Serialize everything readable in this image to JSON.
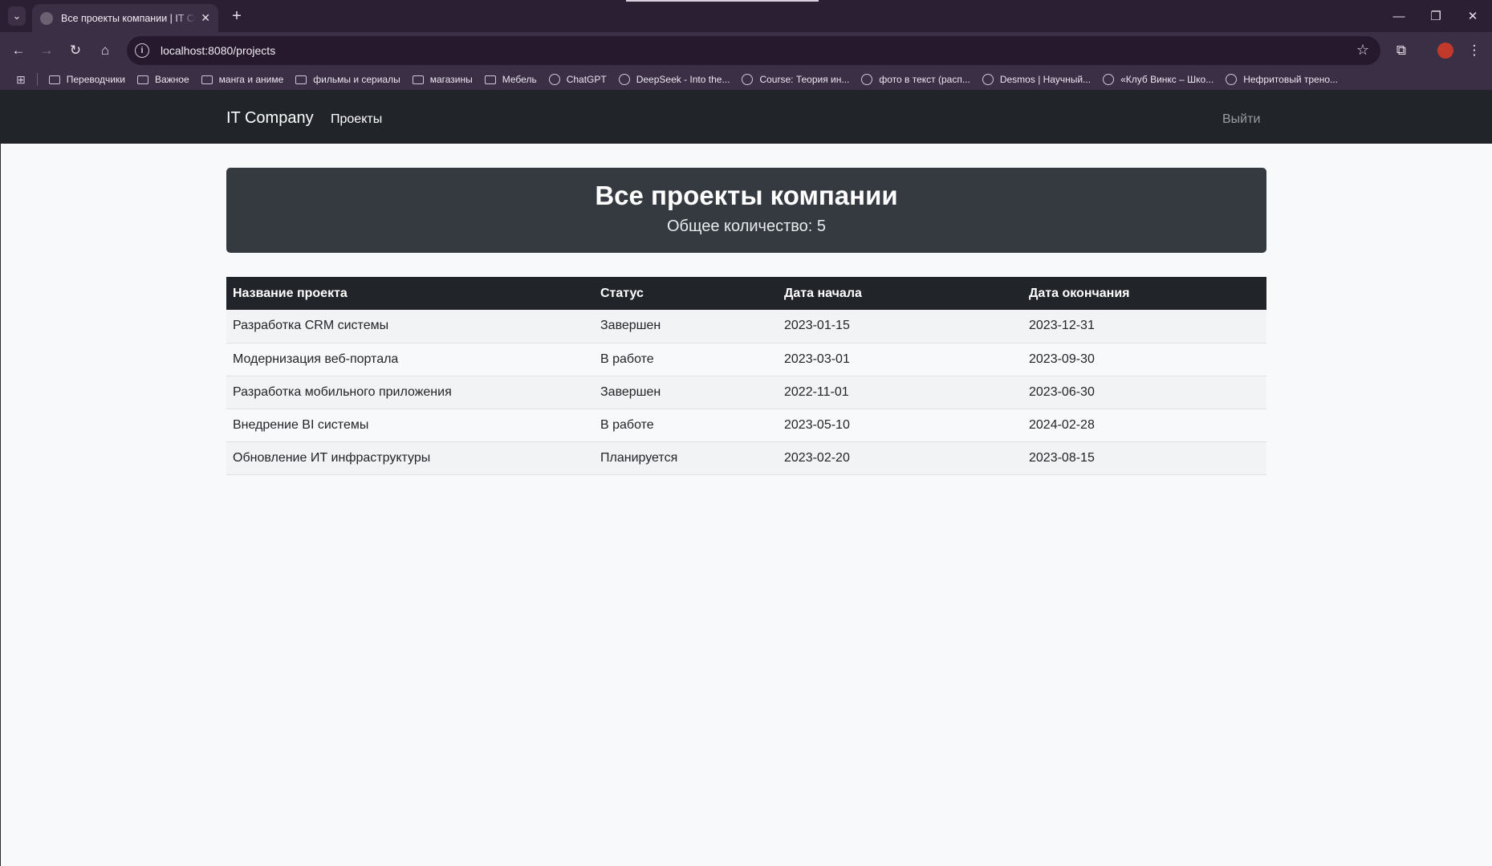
{
  "browser": {
    "tab_title": "Все проекты компании | IT Company",
    "url": "localhost:8080/projects",
    "bookmarks": [
      {
        "label": "Переводчики",
        "icon": "folder-icon"
      },
      {
        "label": "Важное",
        "icon": "folder-icon"
      },
      {
        "label": "манга и аниме",
        "icon": "folder-icon"
      },
      {
        "label": "фильмы и сериалы",
        "icon": "folder-icon"
      },
      {
        "label": "магазины",
        "icon": "folder-icon"
      },
      {
        "label": "Мебель",
        "icon": "folder-icon"
      },
      {
        "label": "ChatGPT",
        "icon": "chatgpt-icon"
      },
      {
        "label": "DeepSeek - Into the...",
        "icon": "deepseek-icon"
      },
      {
        "label": "Course: Теория ин...",
        "icon": "course-icon"
      },
      {
        "label": "фото в текст (расп...",
        "icon": "ocr-icon"
      },
      {
        "label": "Desmos | Научный...",
        "icon": "globe-icon"
      },
      {
        "label": "«Клуб Винкс – Шко...",
        "icon": "globe-icon"
      },
      {
        "label": "Нефритовый трено...",
        "icon": "globe-icon"
      }
    ]
  },
  "navbar": {
    "brand": "IT Company",
    "link": "Проекты",
    "logout": "Выйти"
  },
  "hero": {
    "title": "Все проекты компании",
    "count": "Общее количество: 5"
  },
  "table": {
    "headers": [
      "Название проекта",
      "Статус",
      "Дата начала",
      "Дата окончания"
    ],
    "rows": [
      [
        "Разработка CRM системы",
        "Завершен",
        "2023-01-15",
        "2023-12-31"
      ],
      [
        "Модернизация веб-портала",
        "В работе",
        "2023-03-01",
        "2023-09-30"
      ],
      [
        "Разработка мобильного приложения",
        "Завершен",
        "2022-11-01",
        "2023-06-30"
      ],
      [
        "Внедрение BI системы",
        "В работе",
        "2023-05-10",
        "2024-02-28"
      ],
      [
        "Обновление ИТ инфраструктуры",
        "Планируется",
        "2023-02-20",
        "2023-08-15"
      ]
    ]
  }
}
